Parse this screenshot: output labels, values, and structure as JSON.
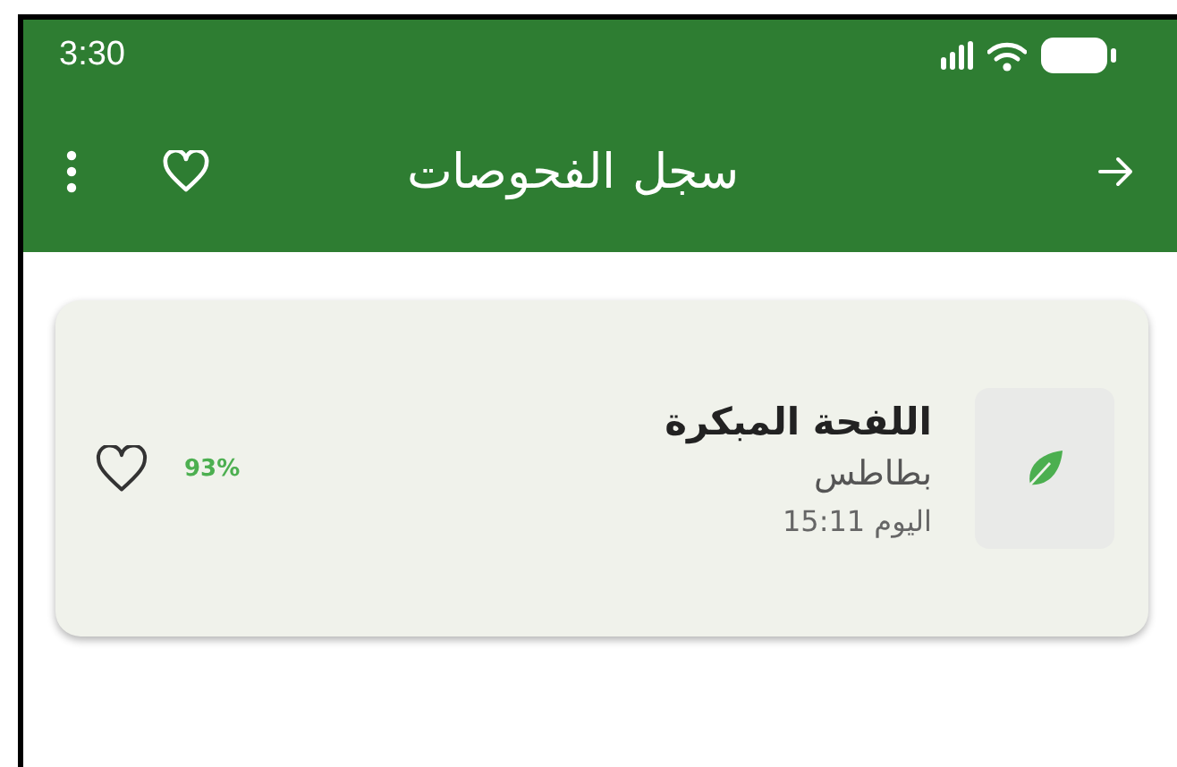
{
  "status_bar": {
    "time": "3:30"
  },
  "app_bar": {
    "title": "سجل الفحوصات"
  },
  "scans": [
    {
      "title": "اللفحة المبكرة",
      "plant": "بطاطس",
      "time": "اليوم 15:11",
      "confidence": "93%",
      "favorite": false
    }
  ]
}
